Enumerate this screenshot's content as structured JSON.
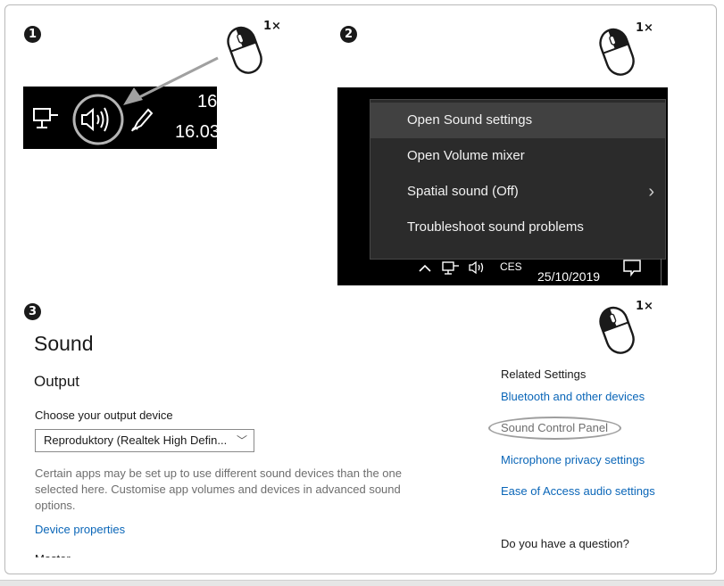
{
  "steps": [
    {
      "number": "1",
      "clicks": "1×"
    },
    {
      "number": "2",
      "clicks": "1×"
    },
    {
      "number": "3",
      "clicks": "1×"
    }
  ],
  "taskbar1": {
    "clock_top": "16",
    "clock_bottom": "16.03",
    "icons": [
      "network-icon",
      "speaker-icon",
      "pen-icon"
    ]
  },
  "context_menu": {
    "items": [
      {
        "label": "Open Sound settings",
        "highlighted": true
      },
      {
        "label": "Open Volume mixer"
      },
      {
        "label": "Spatial sound (Off)",
        "submenu": true
      },
      {
        "label": "Troubleshoot sound problems"
      }
    ],
    "tray": {
      "lang": "CES",
      "date": "25/10/2019"
    }
  },
  "sound": {
    "title": "Sound",
    "output_heading": "Output",
    "choose_label": "Choose your output device",
    "device_selected": "Reproduktory (Realtek High Defin...",
    "description": "Certain apps may be set up to use different sound devices than the one selected here. Customise app volumes and devices in advanced sound options.",
    "device_properties": "Device properties",
    "cutoff_text": "Master volume"
  },
  "related": {
    "title": "Related Settings",
    "bluetooth": "Bluetooth and other devices",
    "sound_control_panel": "Sound Control Panel",
    "microphone": "Microphone privacy settings",
    "ease_of_access": "Ease of Access audio settings",
    "question": "Do you have a question?"
  },
  "colors": {
    "link": "#0a66b8",
    "menu_bg": "#2b2b2b",
    "menu_hover": "#414141",
    "taskbar": "#000000",
    "highlight_ring": "#9e9e9e"
  }
}
